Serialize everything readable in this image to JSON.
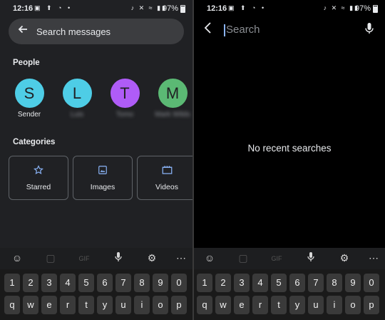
{
  "left": {
    "status": {
      "time": "12:16",
      "battery": "97%"
    },
    "search": {
      "placeholder": "Search messages"
    },
    "people": {
      "title": "People",
      "contacts": [
        {
          "initial": "S",
          "name": "Sender",
          "color": "#4ecde6"
        },
        {
          "initial": "L",
          "name": "Luis",
          "color": "#4ecde6"
        },
        {
          "initial": "T",
          "name": "Tomo",
          "color": "#af5cf7"
        },
        {
          "initial": "M",
          "name": "Mark Wilds",
          "color": "#5bb974"
        }
      ]
    },
    "categories": {
      "title": "Categories",
      "items": [
        {
          "label": "Starred",
          "icon": "star-outline-icon"
        },
        {
          "label": "Images",
          "icon": "image-icon"
        },
        {
          "label": "Videos",
          "icon": "video-icon"
        }
      ]
    },
    "keyboard": {
      "toolbar": [
        "emoji-icon",
        "sticker-icon",
        "gif-icon",
        "mic-icon",
        "settings-icon",
        "more-icon"
      ],
      "numbers": [
        "1",
        "2",
        "3",
        "4",
        "5",
        "6",
        "7",
        "8",
        "9",
        "0"
      ],
      "letters": [
        "q",
        "w",
        "e",
        "r",
        "t",
        "y",
        "u",
        "i",
        "o",
        "p"
      ]
    }
  },
  "right": {
    "status": {
      "time": "12:16",
      "battery": "97%"
    },
    "search": {
      "placeholder": "Search"
    },
    "empty_message": "No recent searches",
    "keyboard": {
      "toolbar": [
        "emoji-icon",
        "sticker-icon",
        "gif-icon",
        "mic-icon",
        "settings-icon",
        "more-icon"
      ],
      "numbers": [
        "1",
        "2",
        "3",
        "4",
        "5",
        "6",
        "7",
        "8",
        "9",
        "0"
      ],
      "letters": [
        "q",
        "w",
        "e",
        "r",
        "t",
        "y",
        "u",
        "i",
        "o",
        "p"
      ]
    }
  }
}
